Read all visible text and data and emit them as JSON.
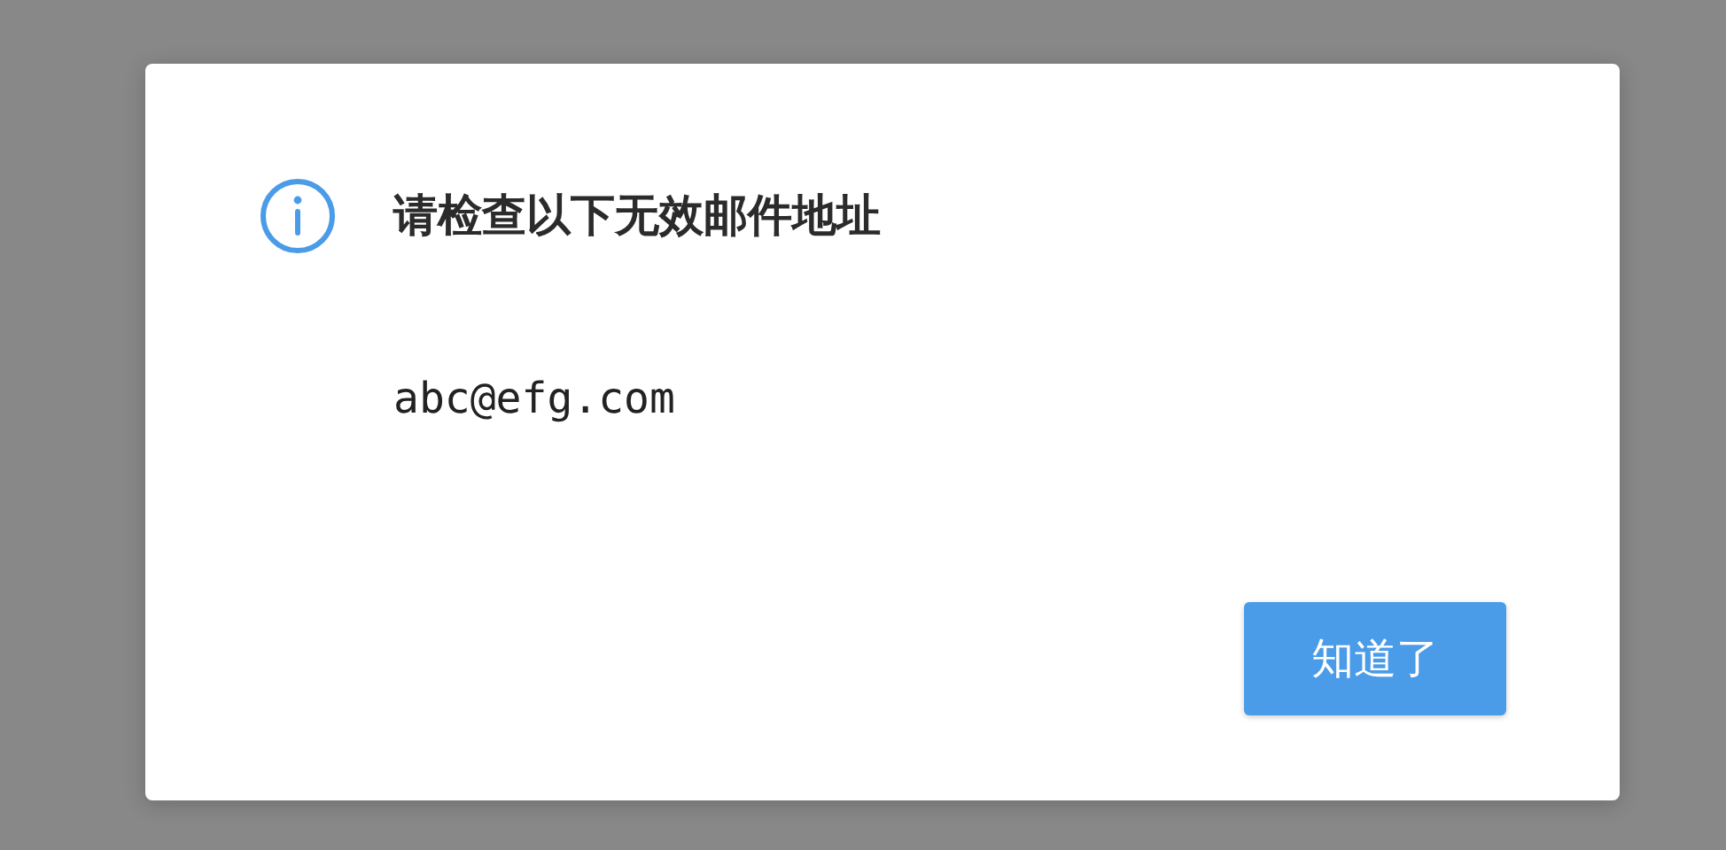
{
  "dialog": {
    "title": "请检查以下无效邮件地址",
    "emails": [
      "abc@efg.com"
    ],
    "buttons": [
      {
        "label": "知道了"
      }
    ]
  }
}
